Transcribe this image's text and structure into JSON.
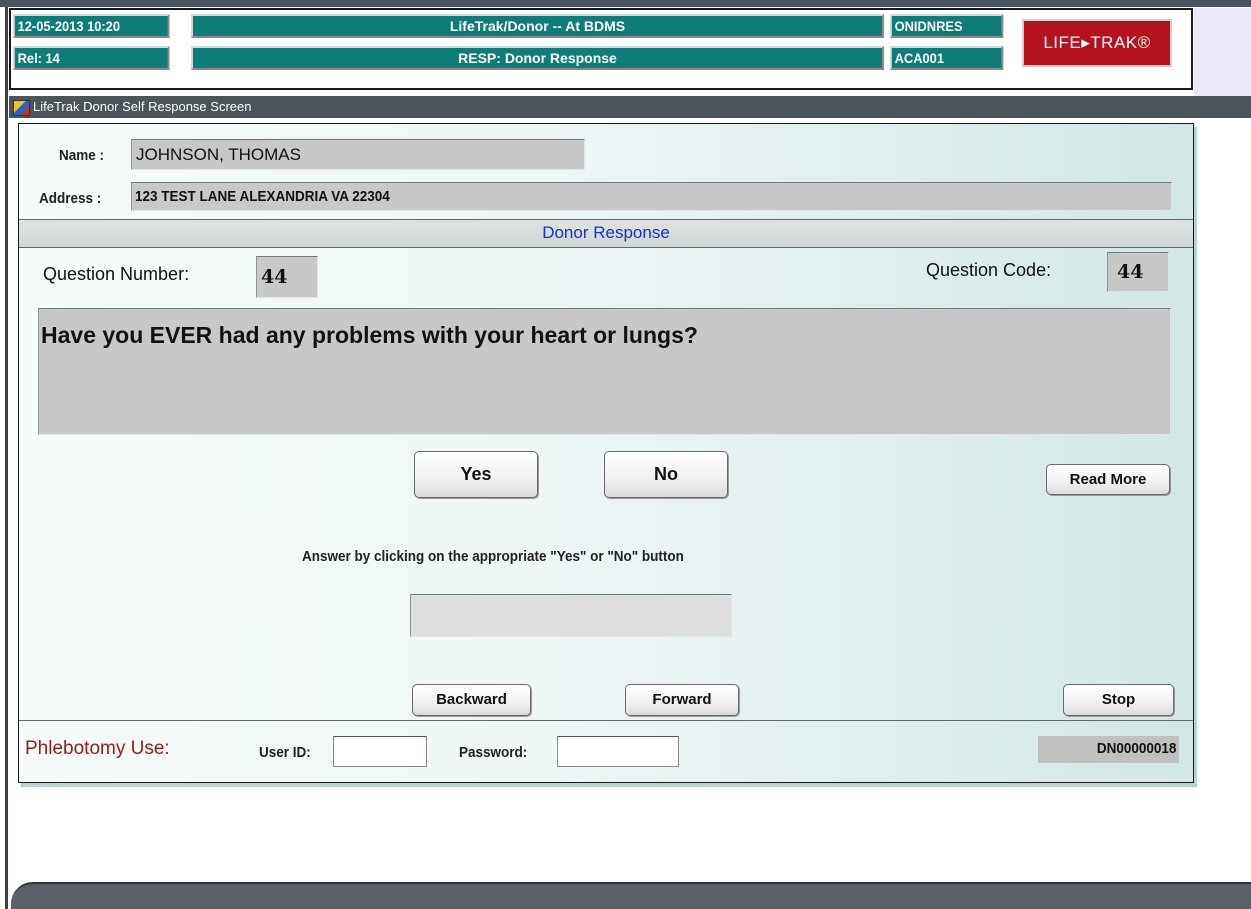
{
  "header": {
    "datetime": "12-05-2013  10:20",
    "release": "Rel: 14",
    "app_title": "LifeTrak/Donor -- At BDMS",
    "screen_title": "RESP: Donor Response",
    "module_code": "ONIDNRES",
    "user_code": "ACA001",
    "logo_text": "LIFE▸TRAK®"
  },
  "window": {
    "title": "LifeTrak Donor Self Response Screen",
    "icon": "lifetrak-app-icon"
  },
  "donor": {
    "name_label": "Name :",
    "name_value": "JOHNSON, THOMAS",
    "address_label": "Address :",
    "address_value": "123 TEST LANE  ALEXANDRIA VA 22304"
  },
  "section": {
    "title": "Donor Response"
  },
  "question": {
    "number_label": "Question Number:",
    "number_value": "44",
    "code_label": "Question Code:",
    "code_value": "44",
    "text": "Have you EVER had any problems with your heart or lungs?"
  },
  "buttons": {
    "yes": "Yes",
    "no": "No",
    "read_more": "Read More",
    "backward": "Backward",
    "forward": "Forward",
    "stop": "Stop"
  },
  "instructions": "Answer by clicking on the appropriate \"Yes\"  or  \"No\" button",
  "answer_value": "",
  "phlebotomy": {
    "label": "Phlebotomy Use:",
    "user_id_label": "User ID:",
    "user_id_value": "",
    "password_label": "Password:",
    "password_value": "",
    "record_id": "DN00000018"
  },
  "colors": {
    "header_teal": "#0e7d78",
    "logo_red": "#b5121b",
    "section_title_blue": "#1a2fc8",
    "phlebotomy_label": "#9b1b1b",
    "field_gray": "#c8c8c8"
  }
}
